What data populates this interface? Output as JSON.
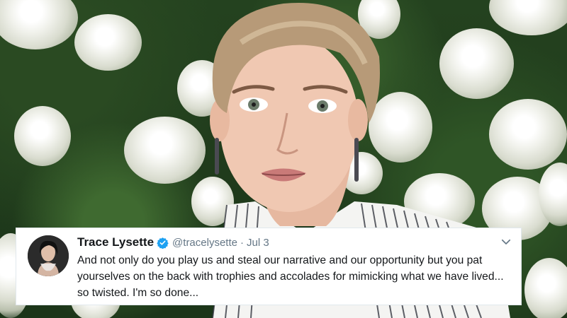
{
  "tweet": {
    "author_name": "Trace Lysette",
    "handle": "@tracelysette",
    "separator": "·",
    "date": "Jul 3",
    "text": "And not only do you play us and steal our narrative and our opportunity but you pat yourselves on the back with trophies and accolades for mimicking what we have lived... so twisted. I'm so done...",
    "verified_icon": "verified-badge-icon",
    "menu_icon": "chevron-down-icon"
  },
  "colors": {
    "verified_blue": "#1da1f2",
    "text_primary": "#14171a",
    "text_secondary": "#657786"
  }
}
